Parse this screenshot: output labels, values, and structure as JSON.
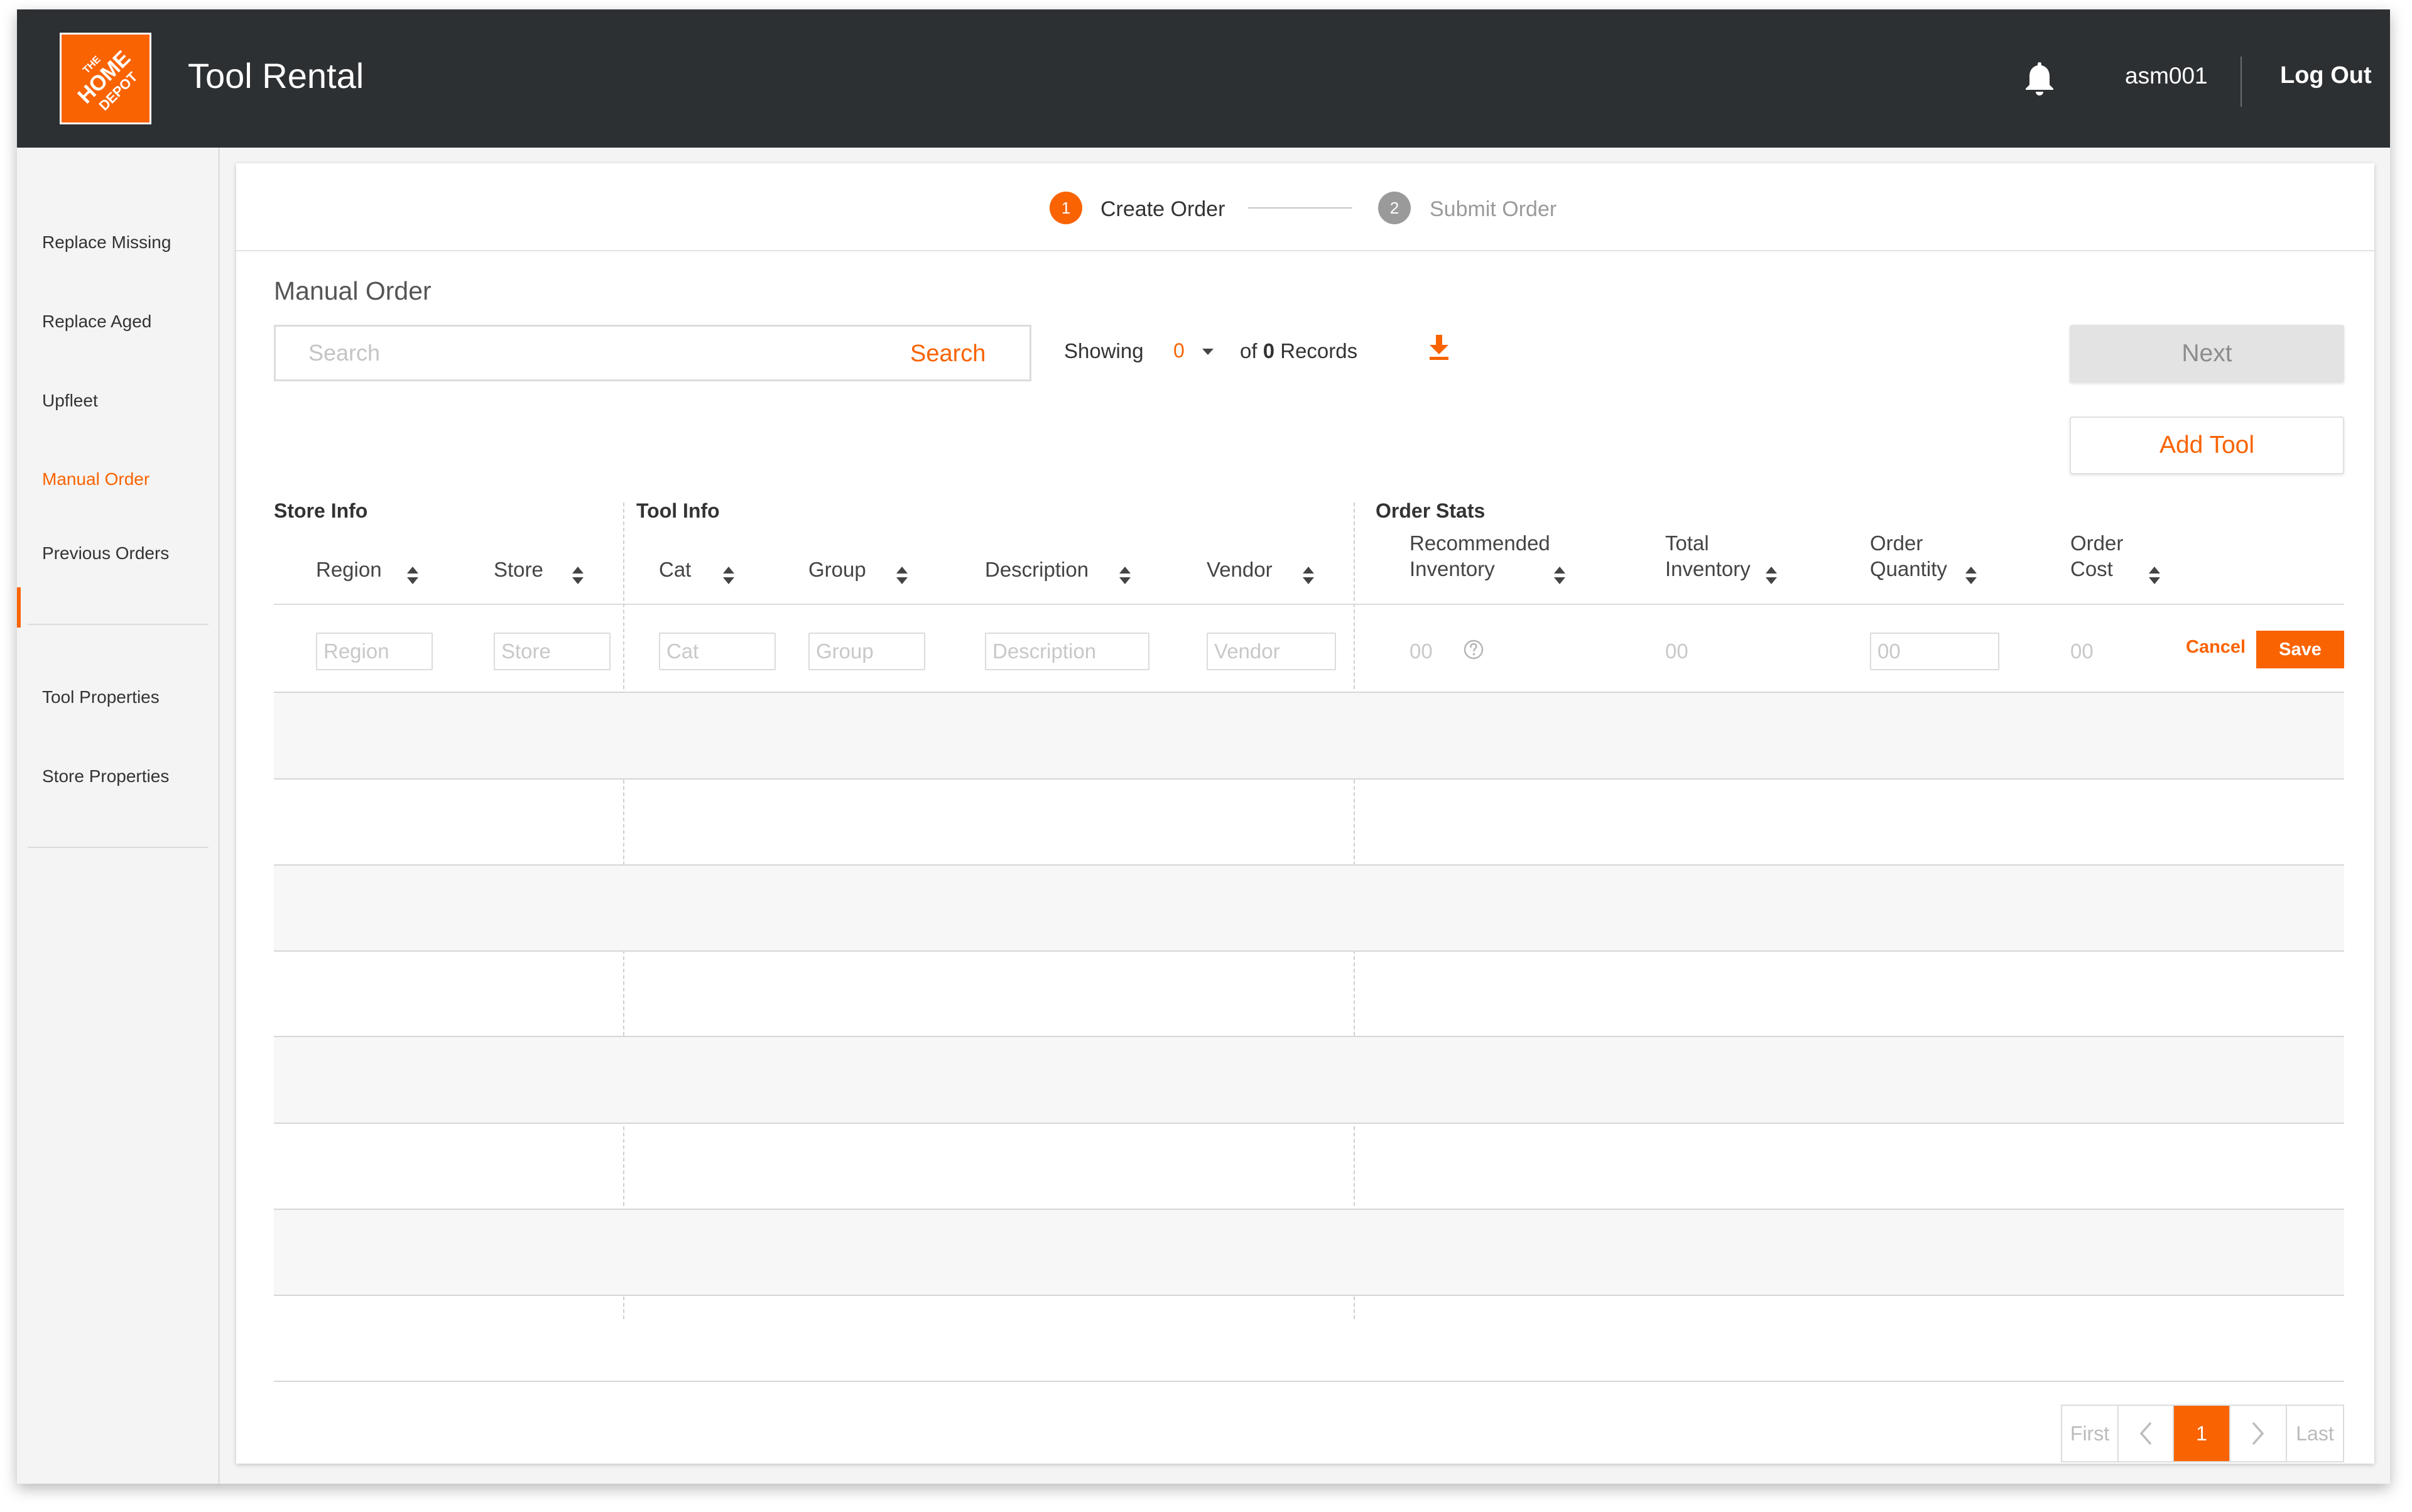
{
  "header": {
    "logo_text": "THE HOME DEPOT",
    "app_title": "Tool Rental",
    "bell_icon": "bell-icon",
    "username": "asm001",
    "logout_label": "Log Out"
  },
  "sidebar": {
    "items": [
      {
        "label": "Replace Missing",
        "active": false
      },
      {
        "label": "Replace Aged",
        "active": false
      },
      {
        "label": "Upfleet",
        "active": false
      },
      {
        "label": "Manual Order",
        "active": true
      },
      {
        "label": "Previous Orders",
        "active": false
      },
      {
        "label": "Tool Properties",
        "active": false
      },
      {
        "label": "Store Properties",
        "active": false
      }
    ]
  },
  "stepper": {
    "steps": [
      {
        "number": "1",
        "label": "Create Order",
        "state": "active"
      },
      {
        "number": "2",
        "label": "Submit Order",
        "state": "inactive"
      }
    ]
  },
  "page": {
    "title": "Manual Order"
  },
  "toolbar": {
    "search_placeholder": "Search",
    "search_button": "Search",
    "showing_label": "Showing",
    "showing_value": "0",
    "records_prefix": "of",
    "records_count": "0",
    "records_suffix": "Records",
    "download_icon": "download-icon",
    "next_label": "Next",
    "next_enabled": false,
    "add_tool_label": "Add Tool"
  },
  "table": {
    "groups": [
      "Store Info",
      "Tool Info",
      "Order Stats"
    ],
    "columns": [
      {
        "key": "region",
        "label": "Region"
      },
      {
        "key": "store",
        "label": "Store"
      },
      {
        "key": "cat",
        "label": "Cat"
      },
      {
        "key": "group",
        "label": "Group"
      },
      {
        "key": "description",
        "label": "Description"
      },
      {
        "key": "vendor",
        "label": "Vendor"
      },
      {
        "key": "recommended_inventory",
        "label": "Recommended Inventory",
        "line1": "Recommended",
        "line2": "Inventory"
      },
      {
        "key": "total_inventory",
        "label": "Total Inventory",
        "line1": "Total",
        "line2": "Inventory"
      },
      {
        "key": "order_quantity",
        "label": "Order Quantity",
        "line1": "Order",
        "line2": "Quantity"
      },
      {
        "key": "order_cost",
        "label": "Order Cost",
        "line1": "Order",
        "line2": "Cost"
      }
    ],
    "edit_row": {
      "region_placeholder": "Region",
      "store_placeholder": "Store",
      "cat_placeholder": "Cat",
      "group_placeholder": "Group",
      "description_placeholder": "Description",
      "vendor_placeholder": "Vendor",
      "recommended_inventory": "00",
      "total_inventory": "00",
      "order_quantity_placeholder": "00",
      "order_cost": "00",
      "cancel_label": "Cancel",
      "save_label": "Save"
    },
    "empty_rows": 8
  },
  "pagination": {
    "first": "First",
    "prev_icon": "chevron-left-icon",
    "current": "1",
    "next_icon": "chevron-right-icon",
    "last": "Last"
  },
  "colors": {
    "accent": "#f96302",
    "topbar": "#2d3033",
    "sidebar_bg": "#f4f4f4"
  }
}
